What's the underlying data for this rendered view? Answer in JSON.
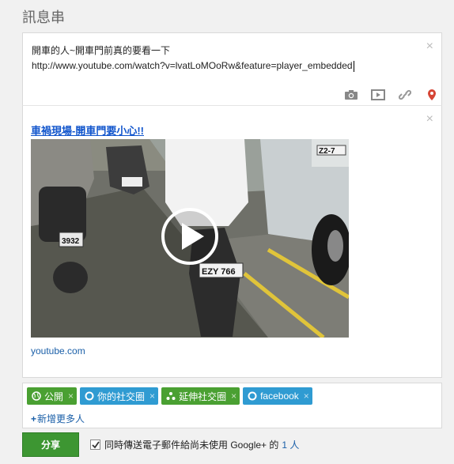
{
  "header": {
    "title": "訊息串"
  },
  "compose": {
    "text_line1": "開車的人~開車門前真的要看一下",
    "text_line2": "http://www.youtube.com/watch?v=lvatLoMOoRw&feature=player_embedded",
    "close_glyph": "×",
    "attach_icons": [
      "camera-icon",
      "video-icon",
      "link-icon",
      "location-pin-icon"
    ]
  },
  "preview": {
    "close_glyph": "×",
    "title": "車禍現場-開車門要小心!!",
    "domain": "youtube.com",
    "plates": [
      "3932",
      "EZY 766",
      "Z2-7"
    ]
  },
  "share": {
    "chips": [
      {
        "label": "公開",
        "color": "#4aa032",
        "icon": "globe-icon"
      },
      {
        "label": "你的社交圈",
        "color": "#2f9bd2",
        "icon": "circle-icon"
      },
      {
        "label": "延伸社交圈",
        "color": "#4aa032",
        "icon": "extended-circles-icon"
      },
      {
        "label": "facebook",
        "color": "#2f9bd2",
        "icon": "circle-icon"
      }
    ],
    "remove_glyph": "×",
    "add_more_plus": "+",
    "add_more_label": "新增更多人"
  },
  "footer": {
    "share_button": "分享",
    "email_label": "同時傳送電子郵件給尚未使用 Google+ 的",
    "email_count": "1 人",
    "email_checked": true
  },
  "colors": {
    "accent_green": "#3d9632",
    "link_blue": "#1a5fa8",
    "chip_blue": "#2f9bd2",
    "chip_green": "#4aa032"
  }
}
